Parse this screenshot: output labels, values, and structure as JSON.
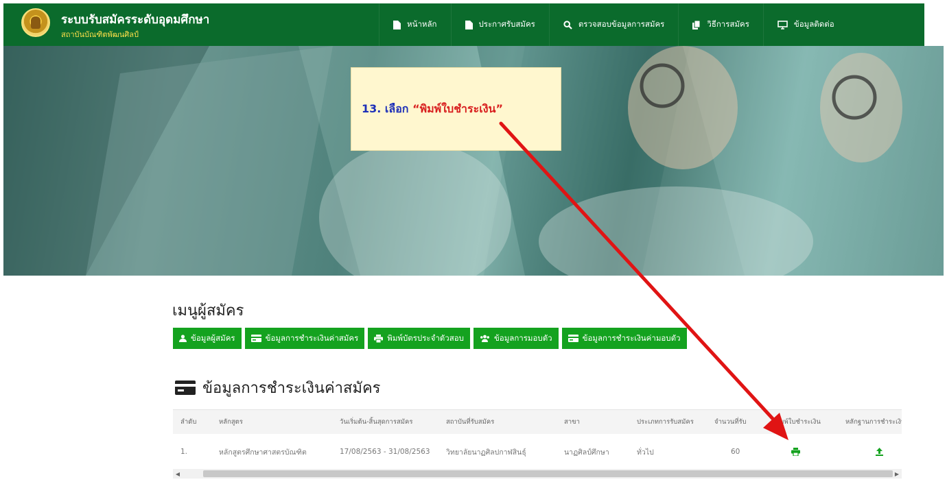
{
  "header": {
    "title": "ระบบรับสมัครระดับอุดมศึกษา",
    "subtitle": "สถาบันบัณฑิตพัฒนศิลป์",
    "nav": [
      {
        "label": "หน้าหลัก",
        "icon": "file-icon"
      },
      {
        "label": "ประกาศรับสมัคร",
        "icon": "file-icon"
      },
      {
        "label": "ตรวจสอบข้อมูลการสมัคร",
        "icon": "search-icon"
      },
      {
        "label": "วิธีการสมัคร",
        "icon": "copy-icon"
      },
      {
        "label": "ข้อมูลติดต่อ",
        "icon": "monitor-icon"
      }
    ]
  },
  "callout": {
    "number": "13. เลือก ",
    "action": "“พิมพ์ใบชำระเงิน”",
    "color_number": "#1d2fb8",
    "color_action": "#d81e1e"
  },
  "menu": {
    "heading": "เมนูผู้สมัคร",
    "buttons": [
      {
        "label": "ข้อมูลผู้สมัคร",
        "icon": "user-icon"
      },
      {
        "label": "ข้อมูลการชำระเงินค่าสมัคร",
        "icon": "credit-card-icon"
      },
      {
        "label": "พิมพ์บัตรประจำตัวสอบ",
        "icon": "printer-icon"
      },
      {
        "label": "ข้อมูลการมอบตัว",
        "icon": "users-icon"
      },
      {
        "label": "ข้อมูลการชำระเงินค่ามอบตัว",
        "icon": "credit-card-icon"
      }
    ],
    "button_color": "#14a21f"
  },
  "payment_section": {
    "heading": "ข้อมูลการชำระเงินค่าสมัคร",
    "icon": "credit-card-icon"
  },
  "table": {
    "columns": [
      "ลำดับ",
      "หลักสูตร",
      "วันเริ่มต้น-สิ้นสุดการสมัคร",
      "สถาบันที่รับสมัคร",
      "สาขา",
      "ประเภทการรับสมัคร",
      "จำนวนที่รับ",
      "พิมพ์ใบชำระเงิน",
      "หลักฐานการชำระเงิน"
    ],
    "rows": [
      {
        "no": "1.",
        "program": "หลักสูตรศึกษาศาสตรบัณฑิต",
        "period": "17/08/2563 - 31/08/2563",
        "institute": "วิทยาลัยนาฏศิลปกาฬสินธุ์",
        "major": "นาฏศิลป์ศึกษา",
        "type": "ทั่วไป",
        "seats": "60",
        "print_icon": "printer-icon",
        "upload_icon": "upload-icon"
      }
    ]
  },
  "colors": {
    "header_bg": "#0b6b2c",
    "subtitle": "#ffe04a",
    "annotation_arrow": "#e01414"
  }
}
